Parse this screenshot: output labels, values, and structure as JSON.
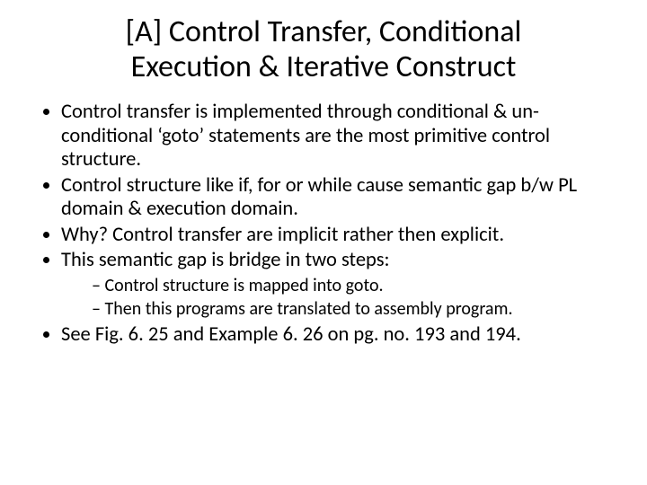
{
  "title": "[A] Control Transfer, Conditional Execution & Iterative Construct",
  "bullets": {
    "b1": "Control transfer is implemented through conditional & un-conditional ‘goto’ statements are the most primitive control structure.",
    "b2": "Control structure like if, for or while cause semantic gap b/w PL domain & execution domain.",
    "b3": "Why? Control transfer are implicit rather then explicit.",
    "b4": "This semantic gap is bridge in two steps:",
    "b4_sub": {
      "s1": "Control structure is mapped into goto.",
      "s2": "Then this programs are translated to assembly program."
    },
    "b5": "See Fig. 6. 25 and Example 6. 26 on pg. no. 193 and 194."
  }
}
